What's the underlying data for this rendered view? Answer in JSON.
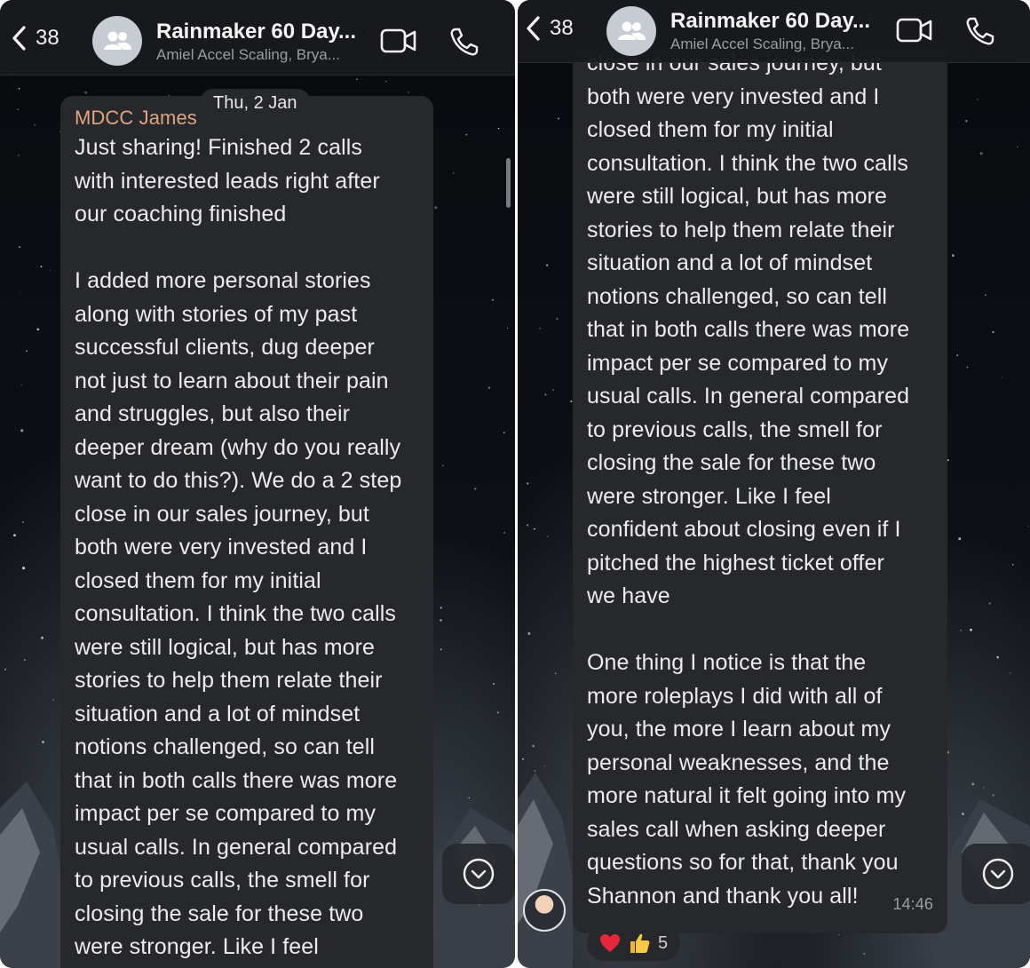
{
  "left": {
    "header": {
      "back_count": "38",
      "title": "Rainmaker 60 Day...",
      "subtitle": "Amiel Accel Scaling, Brya..."
    },
    "date_pill": "Thu, 2 Jan",
    "sender": "MDCC James",
    "lines_p1": [
      "Just sharing! Finished 2 calls",
      "with interested leads right after",
      "our coaching finished"
    ],
    "lines_p2": [
      "I added more personal stories",
      "along with stories of my past",
      "successful clients, dug deeper",
      "not just to learn about their pain",
      "and struggles, but also their",
      "deeper dream (why do you really",
      "want to do this?). We do a 2 step",
      "close in our sales journey, but",
      "both were very invested and I",
      "closed them for my initial",
      "consultation. I think the two calls",
      "were still logical, but has more",
      "stories to help them relate their",
      "situation and a lot of mindset",
      "notions challenged, so can tell",
      "that in both calls there was more",
      "impact per se compared to my",
      "usual calls. In general compared",
      "to previous calls, the smell for",
      "closing the sale for these two",
      "were stronger. Like I feel"
    ]
  },
  "right": {
    "header": {
      "back_count": "38",
      "title": "Rainmaker 60 Day...",
      "subtitle": "Amiel Accel Scaling, Brya..."
    },
    "lines_p1": [
      "close in our sales journey, but",
      "both were very invested and I",
      "closed them for my initial",
      "consultation. I think the two calls",
      "were still logical, but has more",
      "stories to help them relate their",
      "situation and a lot of mindset",
      "notions challenged, so can tell",
      "that in both calls there was more",
      "impact per se compared to my",
      "usual calls. In general compared",
      "to previous calls, the smell for",
      "closing the sale for these two",
      "were stronger. Like I feel",
      "confident about closing even if I",
      "pitched the highest ticket offer",
      "we have"
    ],
    "lines_p2": [
      "One thing I notice is that the",
      "more roleplays I did with all of",
      "you, the more I learn about my",
      "personal weaknesses, and the",
      "more natural it felt going into my",
      "sales call when asking deeper",
      "questions so for that, thank you",
      "Shannon and thank you all!"
    ],
    "time": "14:46",
    "reactions": {
      "emojis": [
        "heart",
        "thumbs-up"
      ],
      "count": "5"
    }
  },
  "colors": {
    "bubble": "#26282c",
    "sender_name": "#e2a480",
    "text": "#ececec",
    "muted": "#9a9da3"
  }
}
